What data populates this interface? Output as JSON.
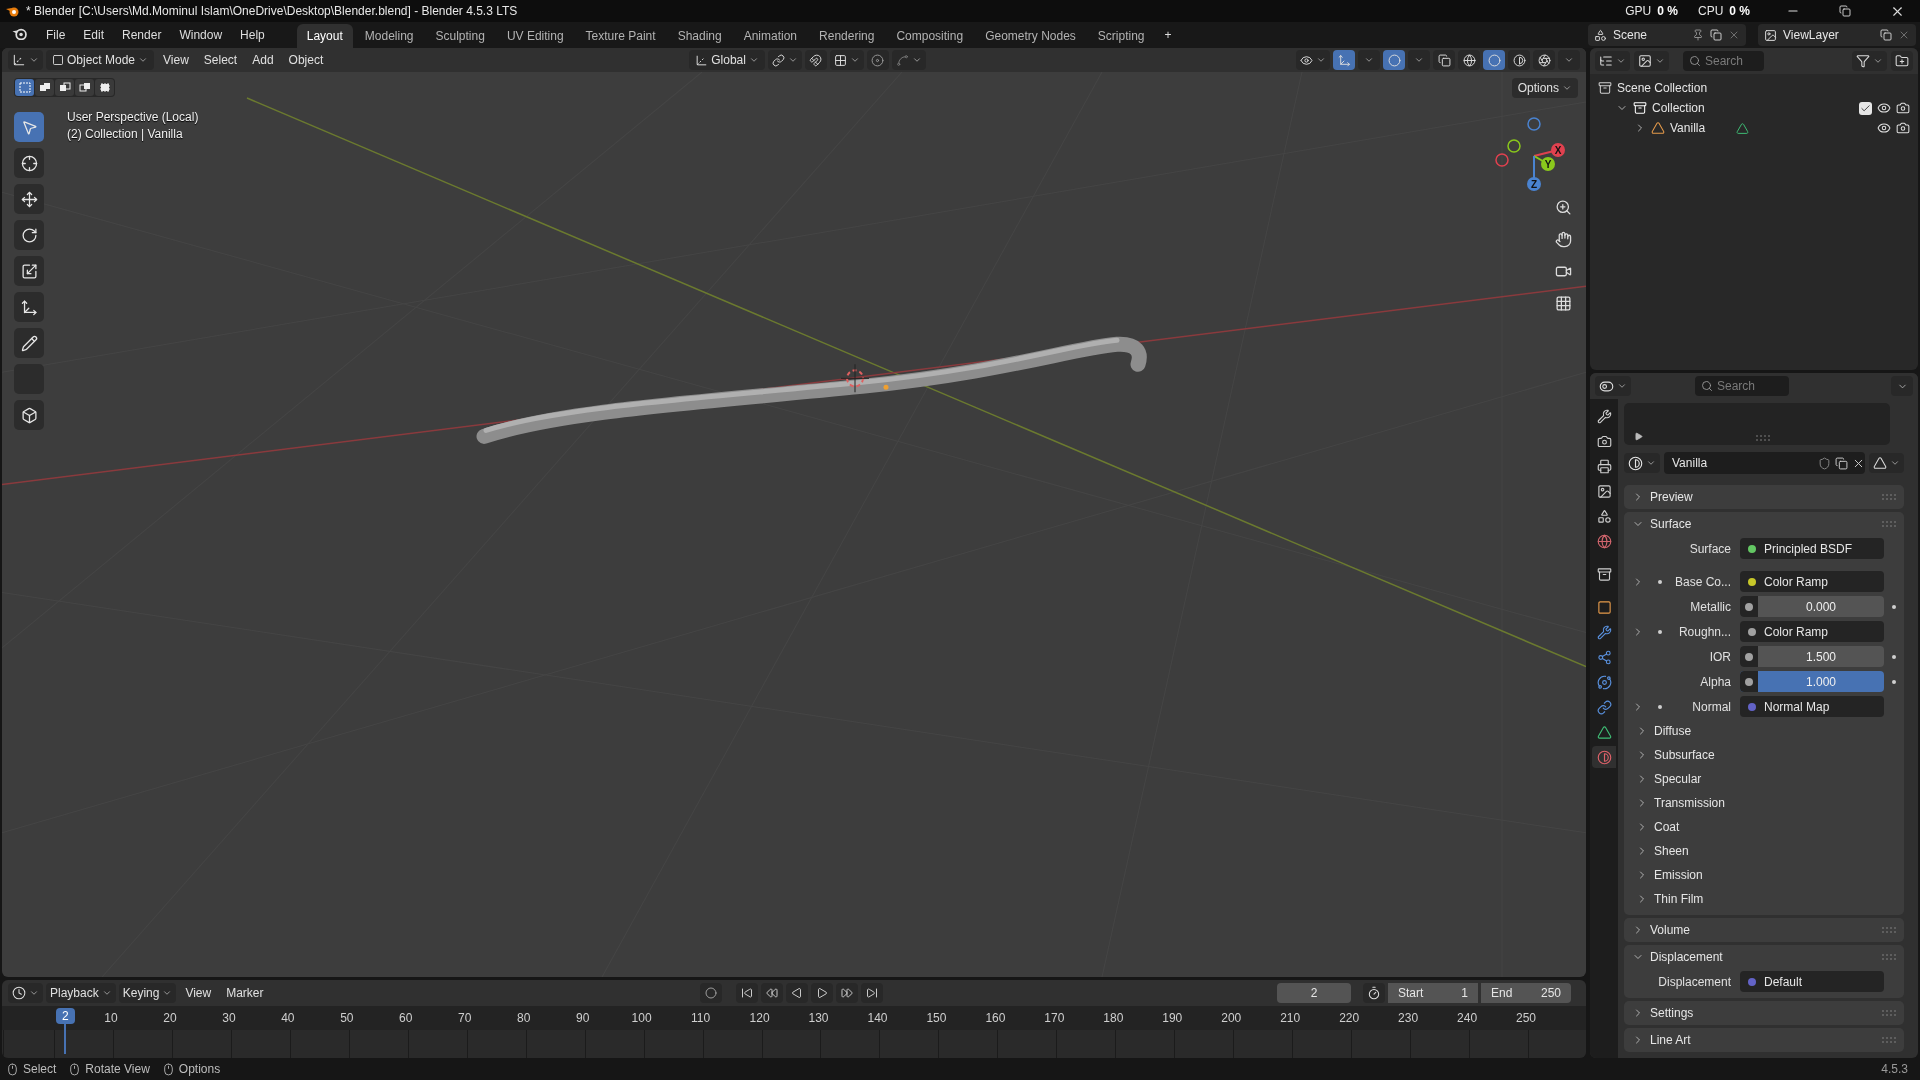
{
  "window": {
    "title": "* Blender [C:\\Users\\Md.Mominul Islam\\OneDrive\\Desktop\\Blender.blend] - Blender 4.5.3 LTS"
  },
  "meters": [
    {
      "label": "GPU",
      "value": "0 %"
    },
    {
      "label": "CPU",
      "value": "0 %"
    }
  ],
  "menu": [
    "File",
    "Edit",
    "Render",
    "Window",
    "Help"
  ],
  "workspaces": [
    {
      "label": "Layout",
      "selected": true
    },
    {
      "label": "Modeling",
      "selected": false
    },
    {
      "label": "Sculpting",
      "selected": false
    },
    {
      "label": "UV Editing",
      "selected": false
    },
    {
      "label": "Texture Paint",
      "selected": false
    },
    {
      "label": "Shading",
      "selected": false
    },
    {
      "label": "Animation",
      "selected": false
    },
    {
      "label": "Rendering",
      "selected": false
    },
    {
      "label": "Compositing",
      "selected": false
    },
    {
      "label": "Geometry Nodes",
      "selected": false
    },
    {
      "label": "Scripting",
      "selected": false
    }
  ],
  "add_workspace": "+",
  "scene": {
    "name": "Scene"
  },
  "view_layer": {
    "name": "ViewLayer"
  },
  "viewport": {
    "mode": "Object Mode",
    "menus": [
      "View",
      "Select",
      "Add",
      "Object"
    ],
    "orientation": "Global",
    "shading": [
      {
        "kind": "wireframe",
        "selected": false
      },
      {
        "kind": "solid",
        "selected": true
      },
      {
        "kind": "material",
        "selected": false
      },
      {
        "kind": "rendered",
        "selected": false
      }
    ],
    "select_modes": [
      {
        "kind": "set",
        "selected": true
      },
      {
        "kind": "extend",
        "selected": false
      },
      {
        "kind": "subtract",
        "selected": false
      },
      {
        "kind": "invert",
        "selected": false
      },
      {
        "kind": "intersect",
        "selected": false
      }
    ],
    "tools": [
      {
        "kind": "select",
        "selected": true
      },
      {
        "kind": "cursor",
        "selected": false
      },
      {
        "kind": "move",
        "selected": false
      },
      {
        "kind": "rotate",
        "selected": false
      },
      {
        "kind": "scale",
        "selected": false
      },
      {
        "kind": "transform",
        "selected": false
      },
      {
        "kind": "annotate",
        "selected": false
      },
      {
        "kind": "measure",
        "selected": false
      },
      {
        "kind": "add_cube",
        "selected": false
      }
    ],
    "options": "Options",
    "info": [
      "User Perspective (Local)",
      "(2) Collection | Vanilla"
    ],
    "axes": [
      {
        "label": "X",
        "color": "#e0414f"
      },
      {
        "label": "Y",
        "color": "#8ac81c"
      },
      {
        "label": "Z",
        "color": "#4a83d0"
      }
    ]
  },
  "outliner": {
    "search": {
      "placeholder": "Search"
    },
    "tree": [
      {
        "label": "Scene Collection",
        "kind": "scene",
        "children": [
          {
            "label": "Collection",
            "kind": "collection",
            "expanded": true,
            "checked": true,
            "children": [
              {
                "label": "Vanilla",
                "kind": "mesh_object",
                "expanded": false
              }
            ]
          }
        ]
      }
    ]
  },
  "properties": {
    "search": {
      "placeholder": "Search"
    },
    "tabs": [
      {
        "kind": "tool",
        "selected": false
      },
      {
        "kind": "render",
        "selected": false
      },
      {
        "kind": "output",
        "selected": false
      },
      {
        "kind": "view_layer",
        "selected": false
      },
      {
        "kind": "scene",
        "selected": false
      },
      {
        "kind": "world",
        "selected": false
      },
      {
        "kind": "collection",
        "selected": false
      },
      {
        "kind": "object",
        "selected": false
      },
      {
        "kind": "modifier",
        "selected": false
      },
      {
        "kind": "particles",
        "selected": false
      },
      {
        "kind": "physics",
        "selected": false
      },
      {
        "kind": "constraints",
        "selected": false
      },
      {
        "kind": "data",
        "selected": false
      },
      {
        "kind": "material",
        "selected": true
      }
    ],
    "material": "Vanilla",
    "panels": [
      {
        "title": "Preview",
        "expanded": false
      },
      {
        "title": "Surface",
        "expanded": true,
        "rows": [
          {
            "kind": "link",
            "label": "Surface",
            "value": "Principled BSDF",
            "color": "#63c763",
            "expandable": false
          },
          {
            "kind": "link",
            "label": "Base Co...",
            "value": "Color Ramp",
            "color": "#c7c729",
            "expandable": true
          },
          {
            "kind": "number",
            "label": "Metallic",
            "value": "0.000",
            "color": "#a1a1a1",
            "expandable": false,
            "selected": false
          },
          {
            "kind": "link",
            "label": "Roughn...",
            "value": "Color Ramp",
            "color": "#a1a1a1",
            "expandable": true
          },
          {
            "kind": "number",
            "label": "IOR",
            "value": "1.500",
            "color": "#a1a1a1",
            "expandable": false,
            "selected": false
          },
          {
            "kind": "number",
            "label": "Alpha",
            "value": "1.000",
            "color": "#a1a1a1",
            "expandable": false,
            "selected": true
          },
          {
            "kind": "link",
            "label": "Normal",
            "value": "Normal Map",
            "color": "#6363c7",
            "expandable": true
          }
        ],
        "subpanels": [
          {
            "title": "Diffuse",
            "expanded": false
          },
          {
            "title": "Subsurface",
            "expanded": false
          },
          {
            "title": "Specular",
            "expanded": false
          },
          {
            "title": "Transmission",
            "expanded": false
          },
          {
            "title": "Coat",
            "expanded": false
          },
          {
            "title": "Sheen",
            "expanded": false
          },
          {
            "title": "Emission",
            "expanded": false
          },
          {
            "title": "Thin Film",
            "expanded": false
          }
        ]
      },
      {
        "title": "Volume",
        "expanded": false
      },
      {
        "title": "Displacement",
        "expanded": true,
        "rows": [
          {
            "kind": "link",
            "label": "Displacement",
            "value": "Default",
            "color": "#6363c7",
            "expandable": false
          }
        ]
      },
      {
        "title": "Settings",
        "expanded": false
      },
      {
        "title": "Line Art",
        "expanded": false
      }
    ]
  },
  "timeline": {
    "menus": [
      "Playback",
      "Keying",
      "View",
      "Marker"
    ],
    "current_frame": "2",
    "start_label": "Start",
    "start": "1",
    "end_label": "End",
    "end": "250",
    "playhead": "2",
    "ticks": [
      "10",
      "20",
      "30",
      "40",
      "50",
      "60",
      "70",
      "80",
      "90",
      "100",
      "110",
      "120",
      "130",
      "140",
      "150",
      "160",
      "170",
      "180",
      "190",
      "200",
      "210",
      "220",
      "230",
      "240",
      "250"
    ]
  },
  "status_bar": {
    "hints": [
      "Select",
      "Rotate View",
      "Options"
    ],
    "version": "4.5.3"
  }
}
